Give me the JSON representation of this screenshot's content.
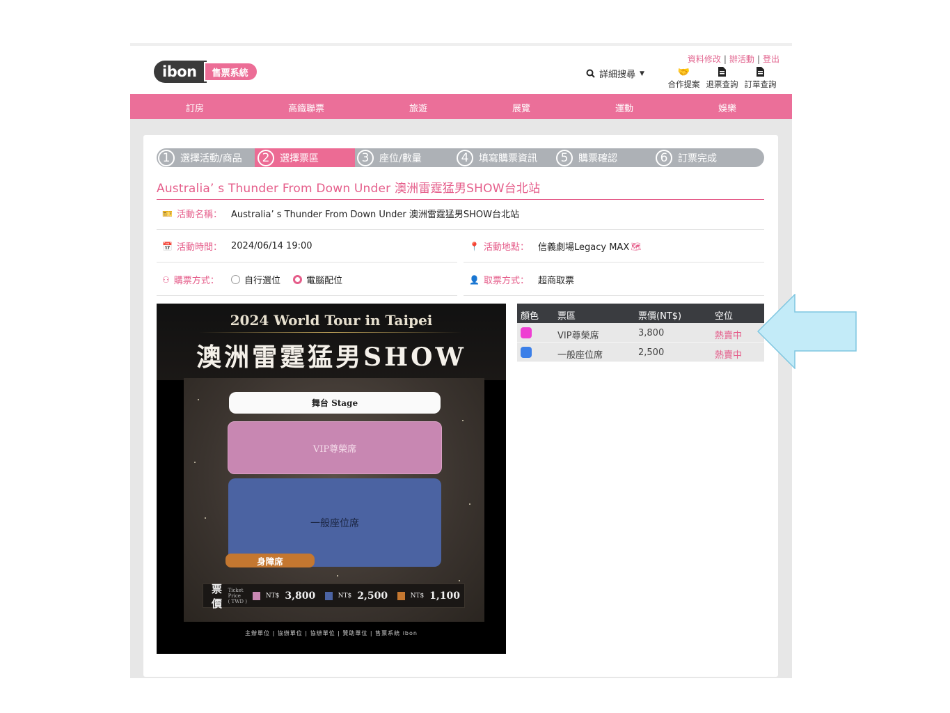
{
  "header": {
    "logo_main": "ibon",
    "logo_tag": "售票系統",
    "search_label": "詳細搜尋",
    "account_links": [
      "資料修改",
      "辦活動",
      "登出"
    ],
    "quick_links": [
      {
        "label": "合作提案",
        "icon": "handshake-icon"
      },
      {
        "label": "退票查詢",
        "icon": "document-icon"
      },
      {
        "label": "訂單查詢",
        "icon": "document-icon"
      }
    ]
  },
  "nav": [
    "訂房",
    "高鐵聯票",
    "旅遊",
    "展覽",
    "運動",
    "娛樂"
  ],
  "steps": [
    {
      "num": "1",
      "label": "選擇活動/商品",
      "active": false
    },
    {
      "num": "2",
      "label": "選擇票區",
      "active": true
    },
    {
      "num": "3",
      "label": "座位/數量",
      "active": false
    },
    {
      "num": "4",
      "label": "填寫購票資訊",
      "active": false
    },
    {
      "num": "5",
      "label": "購票確認",
      "active": false
    },
    {
      "num": "6",
      "label": "訂票完成",
      "active": false
    }
  ],
  "event": {
    "title": "Australia’ s Thunder From Down Under 澳洲雷霆猛男SHOW台北站",
    "name_label": "活動名稱：",
    "name": "Australia’ s Thunder From Down Under 澳洲雷霆猛男SHOW台北站",
    "time_label": "活動時間：",
    "time": "2024/06/14 19:00",
    "venue_label": "活動地點：",
    "venue": "信義劇場Legacy MAX",
    "purchase_label": "購票方式：",
    "purchase_options": [
      "自行選位",
      "電腦配位"
    ],
    "purchase_selected": "電腦配位",
    "pickup_label": "取票方式：",
    "pickup": "超商取票"
  },
  "poster": {
    "subtitle": "2024 World Tour in Taipei",
    "title": "澳洲雷霆猛男SHOW",
    "stage": "舞台 Stage",
    "vip": "VIP尊榮席",
    "general": "一般座位席",
    "accessible": "身障席",
    "price_title": "票價",
    "price_small": "Ticket Price",
    "price_twd": "( TWD )",
    "prices": [
      {
        "nt": "NT$",
        "amount": "3,800",
        "color": "#c887b2"
      },
      {
        "nt": "NT$",
        "amount": "2,500",
        "color": "#4b63a2"
      },
      {
        "nt": "NT$",
        "amount": "1,100",
        "color": "#c47730"
      }
    ],
    "sponsors": "主辦單位 | 協辦單位 | 協辦單位 | 贊助單位 | 售票系統 ibon"
  },
  "zones": {
    "headers": [
      "顏色",
      "票區",
      "票價(NT$)",
      "空位"
    ],
    "rows": [
      {
        "color": "#ee3fd2",
        "name": "VIP尊榮席",
        "price": "3,800",
        "status": "熱賣中"
      },
      {
        "color": "#3b7fe8",
        "name": "一般座位席",
        "price": "2,500",
        "status": "熱賣中"
      }
    ]
  },
  "colors": {
    "brand_pink": "#eb6f99",
    "accent_text": "#e55d8a",
    "arrow": "#bfe8f7"
  }
}
